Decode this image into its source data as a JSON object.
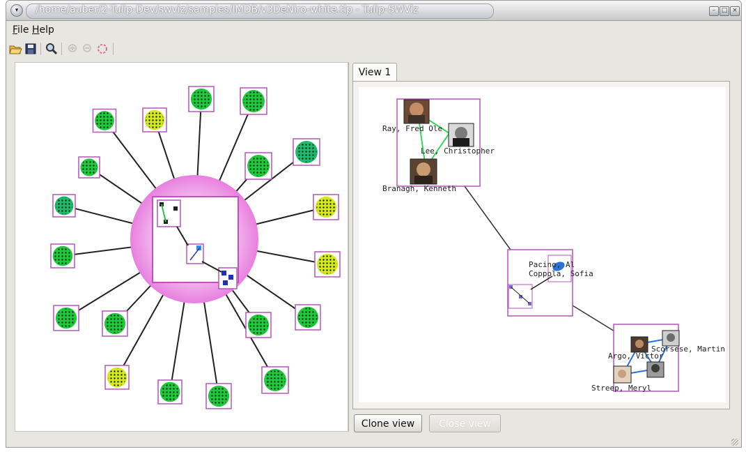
{
  "window": {
    "title": "/home/auber/2-Tulip-Dev/swviz/samples/IMDB/v3DeNiro-white.tlp - Tulip-SWViz"
  },
  "menubar": {
    "file": {
      "mnemonic": "F",
      "rest": "ile"
    },
    "help": {
      "mnemonic": "H",
      "rest": "elp"
    }
  },
  "toolbar": {
    "icons": [
      "folder-open-icon",
      "save-icon",
      "zoom-icon",
      "zoom-in-icon",
      "zoom-out-icon",
      "circle-select-icon"
    ]
  },
  "views": {
    "tab_label": "View 1",
    "clone_button": "Clone view",
    "close_button": "Close view"
  },
  "graph_labels": {
    "ray": "Ray, Fred Ole",
    "lee": "Lee, Christopher",
    "branagh": "Branagh, Kenneth",
    "pacino": "Pacino, Al",
    "coppola": "Coppola, Sofia",
    "scorsese": "Scorsese, Martin",
    "argo": "Argo, Victor",
    "streep": "Streep, Meryl"
  },
  "colors": {
    "sphere": "#ec9be6",
    "node_border": "#b455b8",
    "green_node": "#20c83c",
    "teal_node": "#1fba6e",
    "yellow_node": "#d8e81c",
    "edge_green": "#33d65a",
    "edge_blue": "#2b72d8",
    "window_bg": "#e8e6e1"
  }
}
